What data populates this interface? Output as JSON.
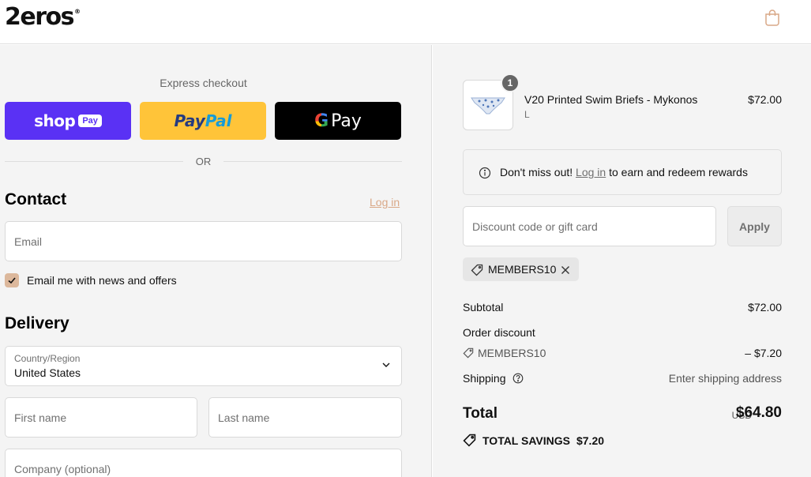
{
  "header": {
    "logo": "2eros",
    "logo_mark": "®"
  },
  "express": {
    "title": "Express checkout",
    "shop_label": "shop",
    "shop_pay": "Pay",
    "paypal_a": "Pay",
    "paypal_b": "Pal",
    "gpay_g": "G",
    "gpay_label": "Pay",
    "or": "OR"
  },
  "contact": {
    "title": "Contact",
    "login": "Log in",
    "email_placeholder": "Email",
    "newsletter_label": "Email me with news and offers",
    "newsletter_checked": true
  },
  "delivery": {
    "title": "Delivery",
    "country_label": "Country/Region",
    "country_value": "United States",
    "first_name": "First name",
    "last_name": "Last name",
    "company": "Company (optional)"
  },
  "order": {
    "quantity": "1",
    "product_name": "V20 Printed Swim Briefs - Mykonos",
    "variant": "L",
    "price": "$72.00"
  },
  "notice": {
    "prefix": "Don't miss out!",
    "link": "Log in",
    "suffix": "to earn and redeem rewards"
  },
  "discount": {
    "placeholder": "Discount code or gift card",
    "apply": "Apply",
    "applied_code": "MEMBERS10"
  },
  "summary": {
    "subtotal_label": "Subtotal",
    "subtotal_value": "$72.00",
    "order_discount_label": "Order discount",
    "discount_code": "MEMBERS10",
    "discount_value": "– $7.20",
    "shipping_label": "Shipping",
    "shipping_value": "Enter shipping address",
    "total_label": "Total",
    "currency": "USD",
    "total_value": "$64.80",
    "savings_label": "TOTAL SAVINGS",
    "savings_value": "$7.20"
  },
  "colors": {
    "shop_pay": "#5a31f4",
    "paypal": "#ffc439",
    "gpay": "#000000",
    "accent": "#d9a887"
  }
}
